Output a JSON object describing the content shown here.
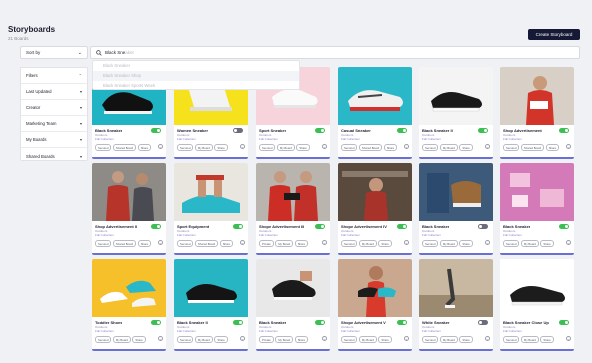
{
  "header": {
    "title": "Storyboards",
    "subtitle": "21 Boards",
    "create_label": "Create Storyboard"
  },
  "sort": {
    "label": "Sort by"
  },
  "search": {
    "typed": "Black Sne",
    "ghost": "aker",
    "suggestions": [
      "Black Sneaker",
      "Black Sneaker Shop",
      "Black Sneaker Sports Week"
    ]
  },
  "filters": {
    "heading": "Filters",
    "items": [
      "Last Updated",
      "Creator",
      "Marketing Team",
      "My Boards",
      "Shared Boards"
    ]
  },
  "cards": [
    {
      "name": "Black Sneaker",
      "type": "Outdoors",
      "collection": "Fall Collection",
      "active": true,
      "pills": [
        "Secured",
        "Shared Board",
        "Share"
      ],
      "image": "teal-shoe"
    },
    {
      "name": "Women Sneaker",
      "type": "Outdoors",
      "collection": "Fall Collection",
      "active": false,
      "pills": [
        "Secured",
        "My Board",
        "Share"
      ],
      "image": "yellow-shoe"
    },
    {
      "name": "Sport Sneaker",
      "type": "Outdoors",
      "collection": "Fall Collection",
      "active": true,
      "pills": [
        "Secured",
        "My Board",
        "Share"
      ],
      "image": "pink-shoe"
    },
    {
      "name": "Casual Sneaker",
      "type": "Outdoors",
      "collection": "Fall Collection",
      "active": true,
      "pills": [
        "Secured",
        "Shared Board",
        "Share"
      ],
      "image": "teal-casual"
    },
    {
      "name": "Black Sneaker II",
      "type": "Outdoors",
      "collection": "Fall Collection",
      "active": true,
      "pills": [
        "Secured",
        "My Board",
        "Share"
      ],
      "image": "black-white"
    },
    {
      "name": "Shop Advertisement",
      "type": "Outdoors",
      "collection": "Fall Collection",
      "active": true,
      "pills": [
        "Secured",
        "Shared Board",
        "Share"
      ],
      "image": "woman-red"
    },
    {
      "name": "Shop Advertisement II",
      "type": "Outdoors",
      "collection": "Fall Collection",
      "active": true,
      "pills": [
        "Secured",
        "Shared Board",
        "Share"
      ],
      "image": "couple"
    },
    {
      "name": "Sport Equipment",
      "type": "Outdoors",
      "collection": "Fall Collection",
      "active": true,
      "pills": [
        "Secured",
        "Shared Board",
        "Share"
      ],
      "image": "laces"
    },
    {
      "name": "Shope Advertisement III",
      "type": "Outdoors",
      "collection": "Fall Collection",
      "active": true,
      "pills": [
        "Private",
        "My Board",
        "Share"
      ],
      "image": "men-red"
    },
    {
      "name": "Shope Advertisement IV",
      "type": "Outdoors",
      "collection": "Fall Collection",
      "active": true,
      "pills": [
        "Secured",
        "My Board",
        "Share"
      ],
      "image": "store"
    },
    {
      "name": "Black Sneaker",
      "type": "Outdoors",
      "collection": "Fall Collection",
      "active": false,
      "pills": [
        "Secured",
        "My Board",
        "Share"
      ],
      "image": "jeans"
    },
    {
      "name": "Black Sneaker",
      "type": "Outdoors",
      "collection": "Fall Collection",
      "active": true,
      "pills": [
        "Secured",
        "My Board",
        "Share"
      ],
      "image": "pink-flat"
    },
    {
      "name": "Toddler Shoes",
      "type": "Outdoors",
      "collection": "Fall Collection",
      "active": true,
      "pills": [
        "Secured",
        "My Board",
        "Share"
      ],
      "image": "yellow-kids"
    },
    {
      "name": "Black Sneaker II",
      "type": "Outdoors",
      "collection": "Fall Collection",
      "active": true,
      "pills": [
        "Secured",
        "My Board",
        "Share"
      ],
      "image": "teal-black"
    },
    {
      "name": "Black Sneaker",
      "type": "Outdoors",
      "collection": "Fall Collection",
      "active": true,
      "pills": [
        "Private",
        "My Board",
        "Share"
      ],
      "image": "hand-shoe"
    },
    {
      "name": "Shope Advertisement V",
      "type": "Outdoors",
      "collection": "Fall Collection",
      "active": true,
      "pills": [
        "Secured",
        "My Board",
        "Share"
      ],
      "image": "woman-holding"
    },
    {
      "name": "White Sneaker",
      "type": "Outdoors",
      "collection": "Fall Collection",
      "active": false,
      "pills": [
        "Secured",
        "My Board",
        "Share"
      ],
      "image": "runner"
    },
    {
      "name": "Black Sneaker Close Up",
      "type": "Outdoors",
      "collection": "Fall Collection",
      "active": true,
      "pills": [
        "Secured",
        "My Board",
        "Share"
      ],
      "image": "white-black"
    }
  ],
  "colors": {
    "accent": "#151936",
    "toggle_on": "#3cbf52",
    "toggle_off": "#6b6e7a",
    "card_border": "#6a6fd6"
  }
}
